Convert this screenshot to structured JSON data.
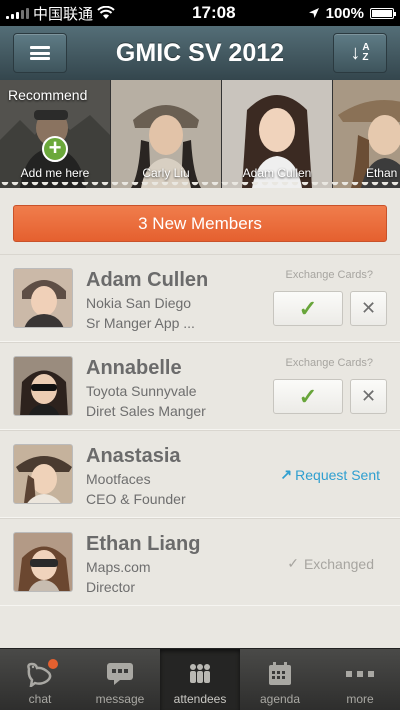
{
  "status_bar": {
    "carrier": "中国联通",
    "time": "17:08",
    "battery": "100%"
  },
  "nav": {
    "title": "GMIC SV 2012",
    "sort_letters": [
      "A",
      "Z"
    ]
  },
  "recommend": {
    "label": "Recommend",
    "tiles": [
      {
        "label": "Add me here"
      },
      {
        "label": "Carly Liu"
      },
      {
        "label": "Adam Cullen"
      },
      {
        "label": "Ethan Li"
      }
    ]
  },
  "banner": {
    "label": "3 New Members"
  },
  "members": [
    {
      "name": "Adam Cullen",
      "line1": "Nokia San Diego",
      "line2": "Sr Manger App  ...",
      "status": "pending",
      "exchange_label": "Exchange Cards?"
    },
    {
      "name": "Annabelle",
      "line1": "Toyota Sunnyvale",
      "line2": "Diret Sales Manger",
      "status": "pending",
      "exchange_label": "Exchange Cards?"
    },
    {
      "name": "Anastasia",
      "line1": "Mootfaces",
      "line2": "CEO & Founder",
      "status": "request_sent",
      "status_label": "Request Sent"
    },
    {
      "name": "Ethan Liang",
      "line1": "Maps.com",
      "line2": "Director",
      "status": "exchanged",
      "status_label": "Exchanged"
    }
  ],
  "tab_bar": {
    "tabs": [
      {
        "label": "chat",
        "icon": "bird-icon",
        "badge": true
      },
      {
        "label": "message",
        "icon": "speech-bubble-icon"
      },
      {
        "label": "attendees",
        "icon": "people-icon",
        "active": true
      },
      {
        "label": "agenda",
        "icon": "calendar-icon"
      },
      {
        "label": "more",
        "icon": "dots-icon"
      }
    ]
  },
  "colors": {
    "accent": "#e5602f",
    "accept": "#68a53a",
    "link": "#2f9fd0",
    "nav": "#3e545c"
  }
}
